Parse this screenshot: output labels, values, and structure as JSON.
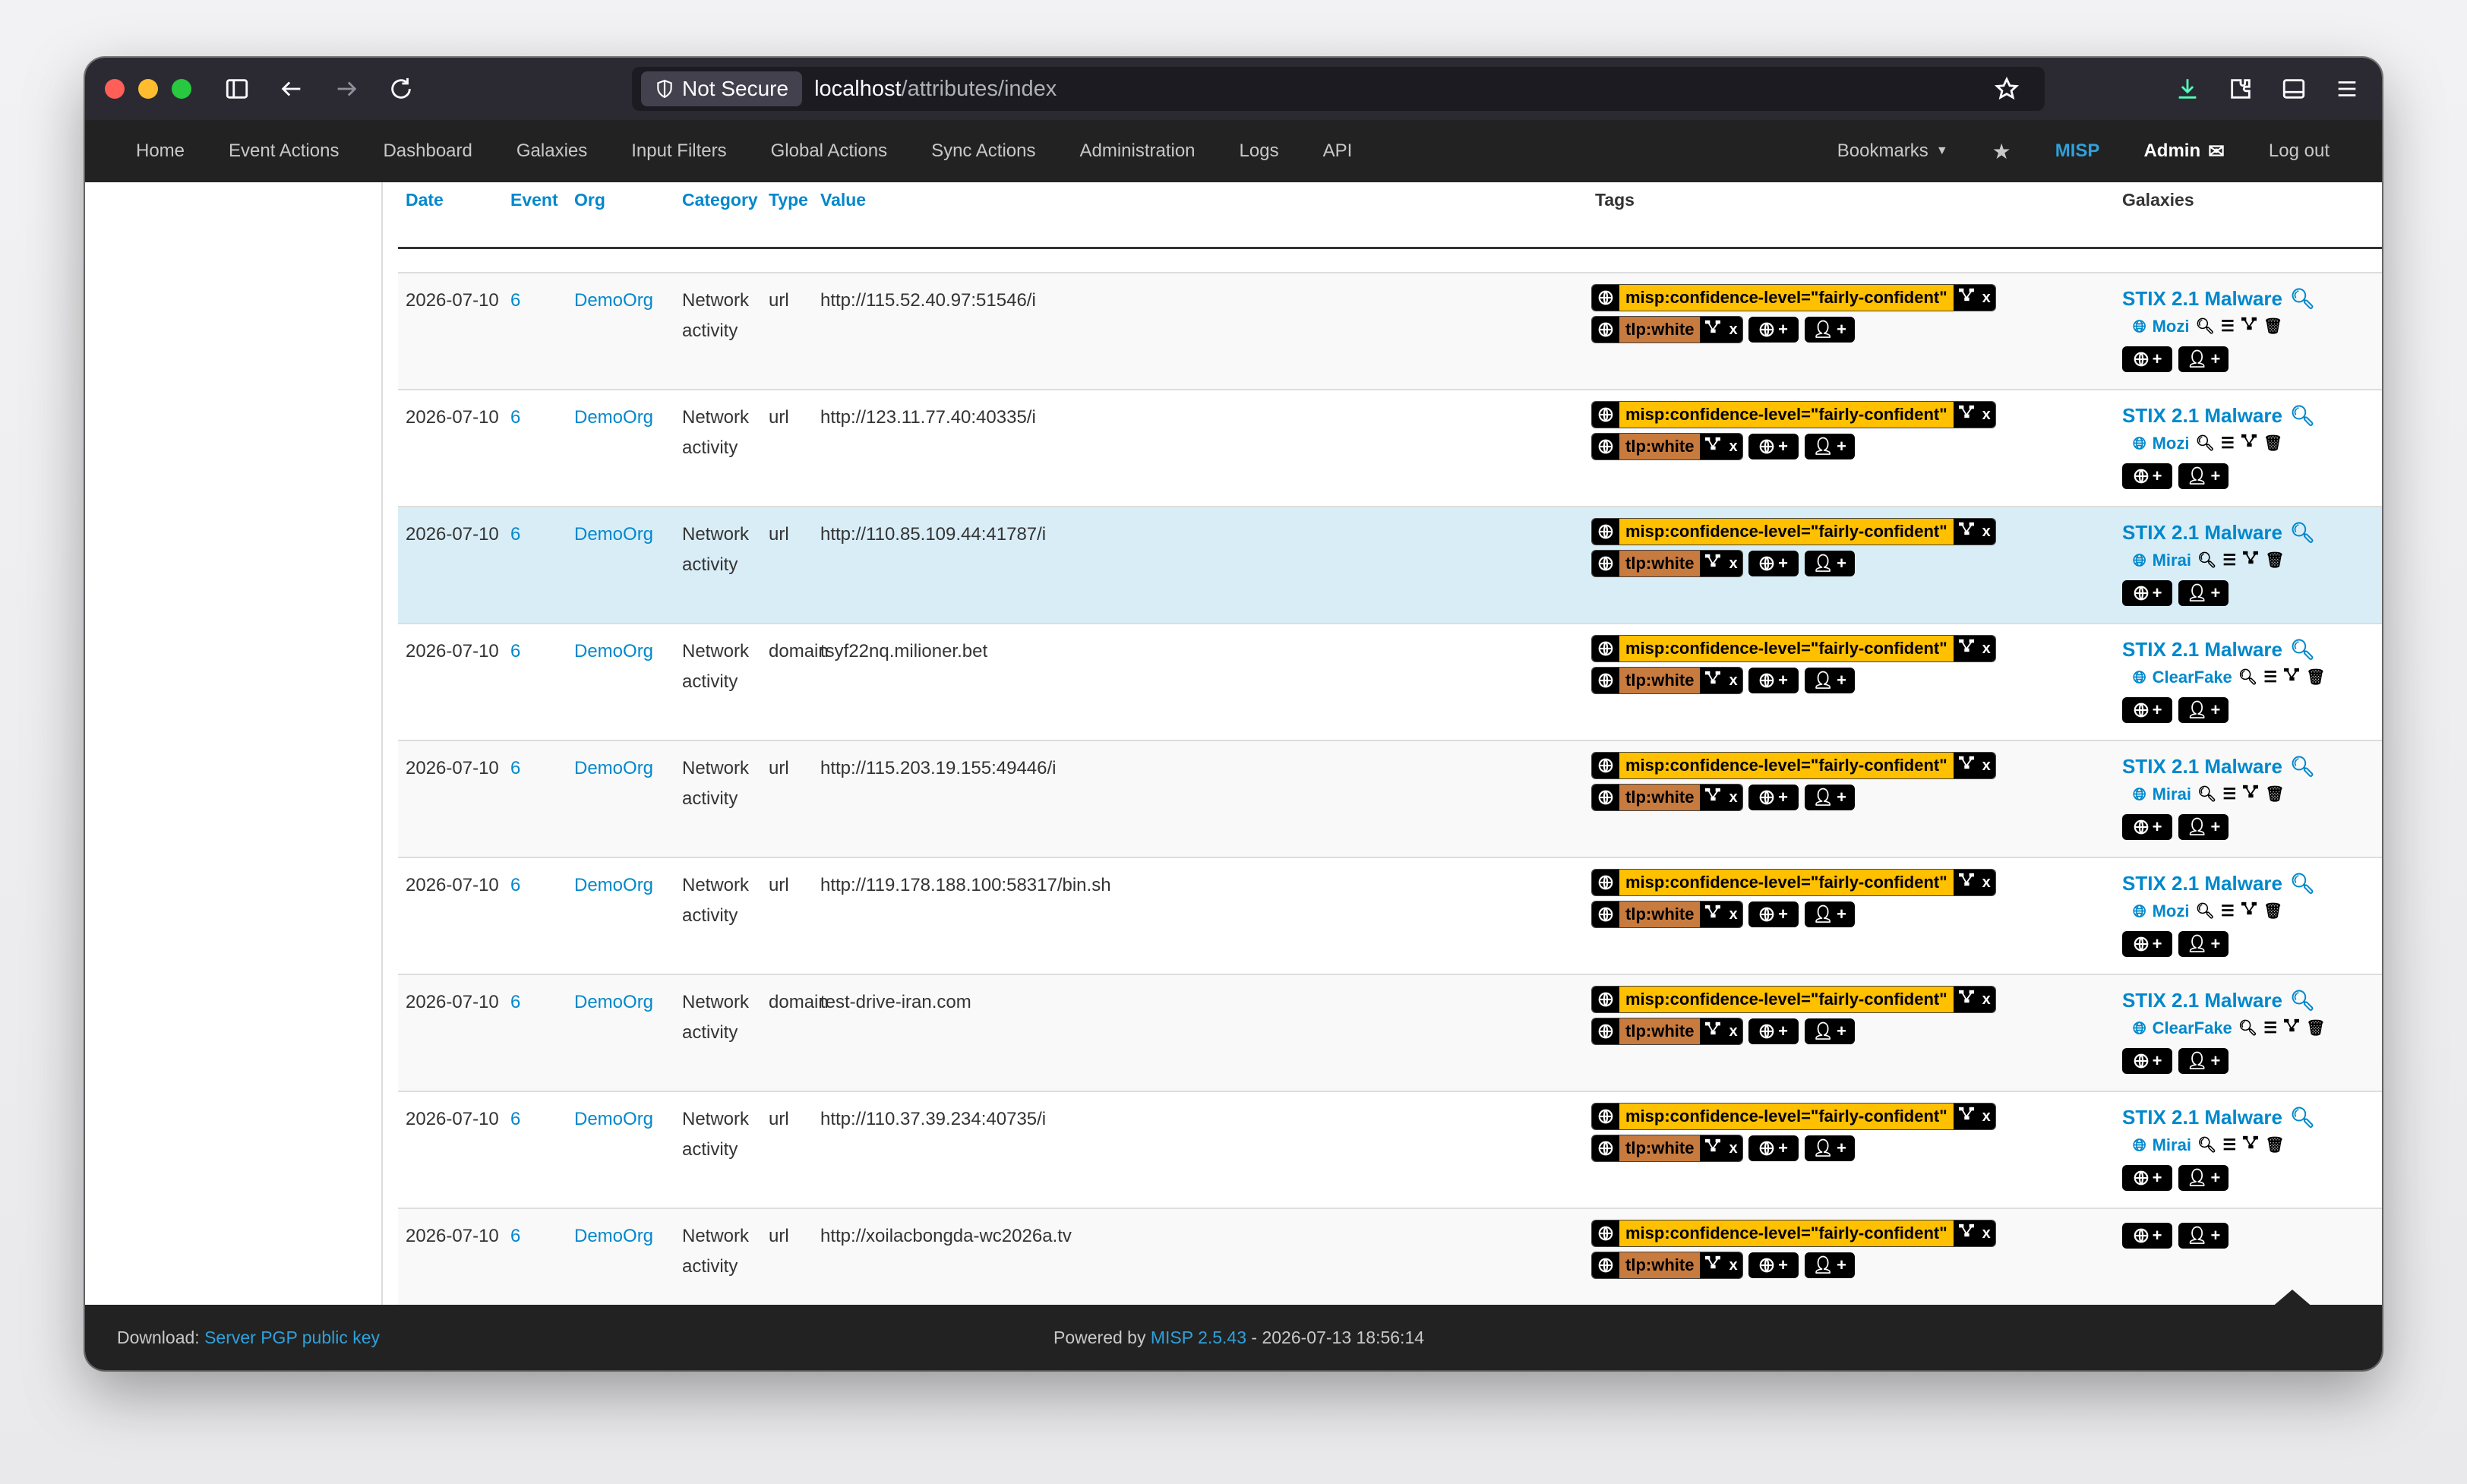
{
  "browser": {
    "security_label": "Not Secure",
    "url_host": "localhost",
    "url_path": "/attributes/index"
  },
  "nav": {
    "items": [
      "Home",
      "Event Actions",
      "Dashboard",
      "Galaxies",
      "Input Filters",
      "Global Actions",
      "Sync Actions",
      "Administration",
      "Logs",
      "API"
    ],
    "bookmarks": "Bookmarks",
    "brand": "MISP",
    "user": "Admin",
    "logout": "Log out"
  },
  "table": {
    "headers": {
      "date": "Date",
      "event": "Event",
      "org": "Org",
      "category": "Category",
      "type": "Type",
      "value": "Value",
      "tags": "Tags",
      "galaxies": "Galaxies"
    },
    "tag_confidence": "misp:confidence-level=\"fairly-confident\"",
    "tag_tlp": "tlp:white",
    "galaxy_title": "STIX 2.1 Malware",
    "rows": [
      {
        "date": "2026-07-10",
        "event": "6",
        "org": "DemoOrg",
        "category": "Network activity",
        "type": "url",
        "value": "http://115.52.40.97:51546/i",
        "galaxy": "Mozi"
      },
      {
        "date": "2026-07-10",
        "event": "6",
        "org": "DemoOrg",
        "category": "Network activity",
        "type": "url",
        "value": "http://123.11.77.40:40335/i",
        "galaxy": "Mozi"
      },
      {
        "date": "2026-07-10",
        "event": "6",
        "org": "DemoOrg",
        "category": "Network activity",
        "type": "url",
        "value": "http://110.85.109.44:41787/i",
        "galaxy": "Mirai"
      },
      {
        "date": "2026-07-10",
        "event": "6",
        "org": "DemoOrg",
        "category": "Network activity",
        "type": "domain",
        "value": "tsyf22nq.milioner.bet",
        "galaxy": "ClearFake"
      },
      {
        "date": "2026-07-10",
        "event": "6",
        "org": "DemoOrg",
        "category": "Network activity",
        "type": "url",
        "value": "http://115.203.19.155:49446/i",
        "galaxy": "Mirai"
      },
      {
        "date": "2026-07-10",
        "event": "6",
        "org": "DemoOrg",
        "category": "Network activity",
        "type": "url",
        "value": "http://119.178.188.100:58317/bin.sh",
        "galaxy": "Mozi"
      },
      {
        "date": "2026-07-10",
        "event": "6",
        "org": "DemoOrg",
        "category": "Network activity",
        "type": "domain",
        "value": "test-drive-iran.com",
        "galaxy": "ClearFake"
      },
      {
        "date": "2026-07-10",
        "event": "6",
        "org": "DemoOrg",
        "category": "Network activity",
        "type": "url",
        "value": "http://110.37.39.234:40735/i",
        "galaxy": "Mirai"
      },
      {
        "date": "2026-07-10",
        "event": "6",
        "org": "DemoOrg",
        "category": "Network activity",
        "type": "url",
        "value": "http://xoilacbongda-wc2026a.tv",
        "galaxy": ""
      }
    ]
  },
  "footer": {
    "download_label": "Download:",
    "download_link": "Server PGP public key",
    "powered_by": "Powered by",
    "misp_version": "MISP 2.5.43",
    "timestamp": "- 2026-07-13 18:56:14"
  }
}
